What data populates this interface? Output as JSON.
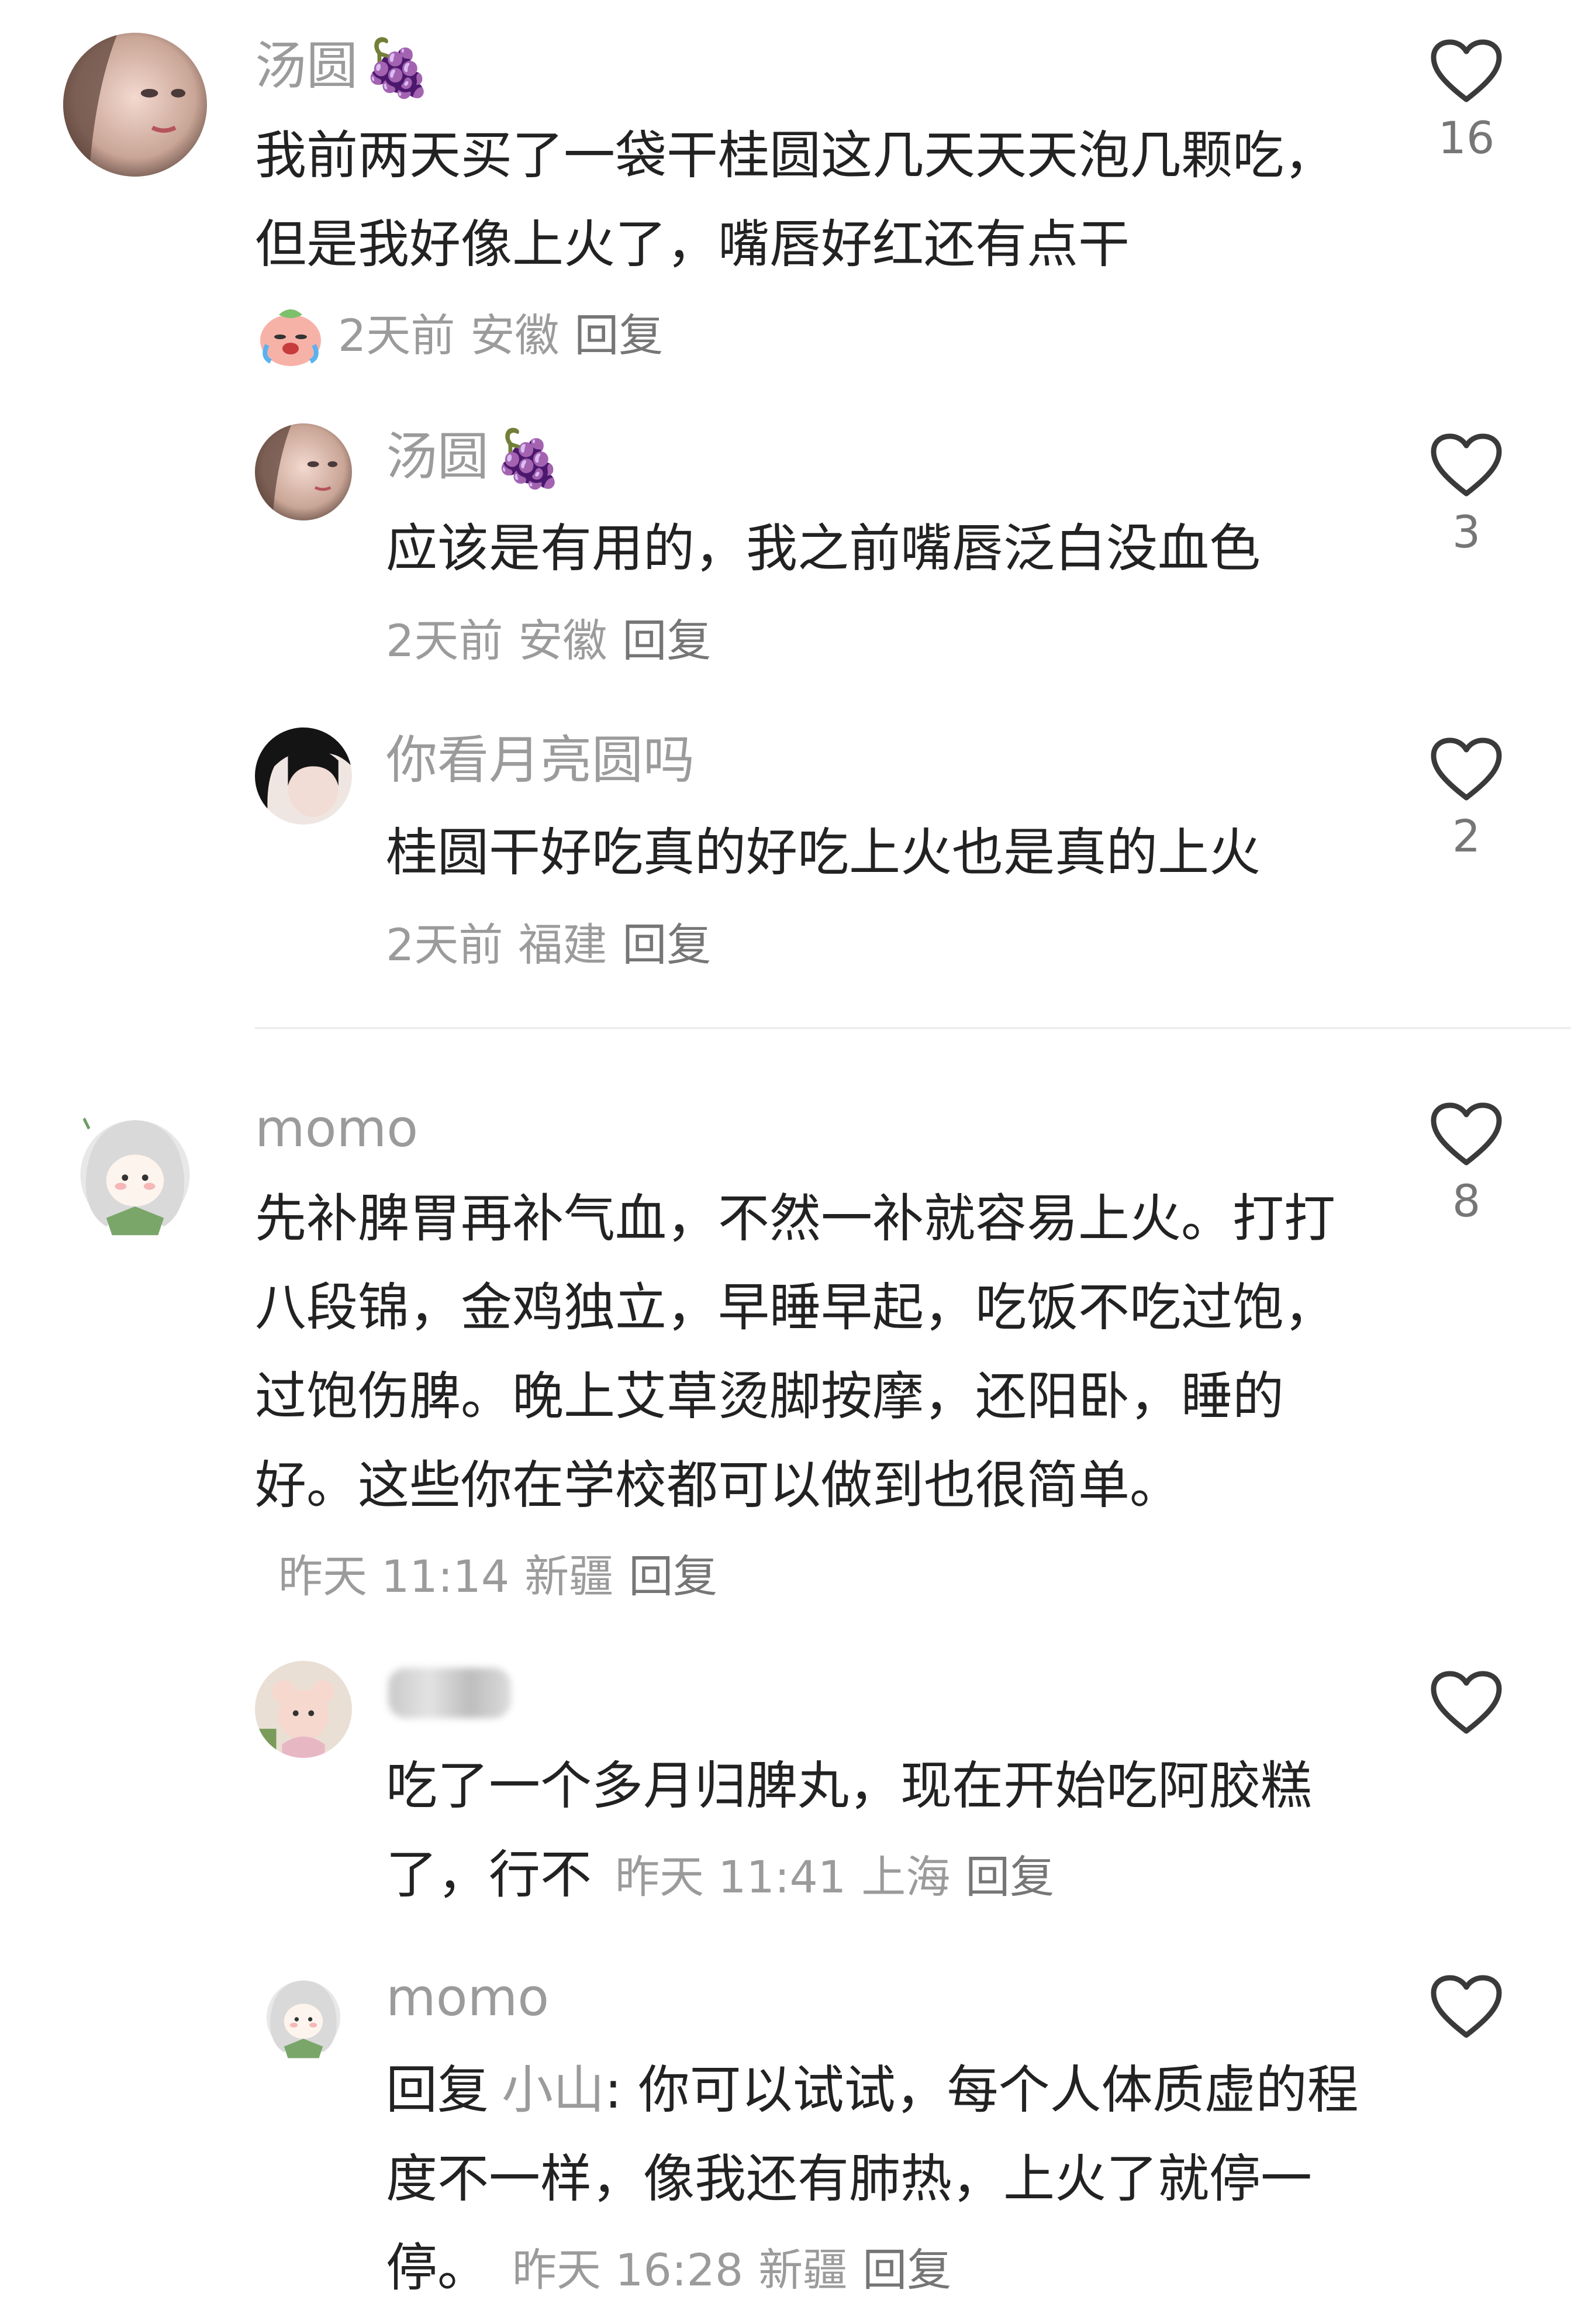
{
  "comments": [
    {
      "user": "汤圆",
      "name_emoji": "🍇",
      "text": "我前两天买了一袋干桂圆这几天天天泡几颗吃，但是我好像上火了，嘴唇好红还有点干",
      "time": "2天前",
      "location": "安徽",
      "reply_label": "回复",
      "likes": "16",
      "inline_emoji": "crying-peach-emoji",
      "replies": [
        {
          "user": "汤圆",
          "name_emoji": "🍇",
          "text": "应该是有用的，我之前嘴唇泛白没血色",
          "time": "2天前",
          "location": "安徽",
          "reply_label": "回复",
          "likes": "3"
        },
        {
          "user": "你看月亮圆吗",
          "text": "桂圆干好吃真的好吃上火也是真的上火",
          "time": "2天前",
          "location": "福建",
          "reply_label": "回复",
          "likes": "2"
        }
      ]
    },
    {
      "user": "momo",
      "text": "先补脾胃再补气血，不然一补就容易上火。打打八段锦，金鸡独立，早睡早起，吃饭不吃过饱，过饱伤脾。晚上艾草烫脚按摩，还阳卧，睡的好。这些你在学校都可以做到也很简单。",
      "time": "昨天 11:14",
      "location": "新疆",
      "reply_label": "回复",
      "likes": "8",
      "replies": [
        {
          "user": "",
          "text": "吃了一个多月归脾丸，现在开始吃阿胶糕了，行不",
          "time": "昨天 11:41",
          "location": "上海",
          "reply_label": "回复",
          "likes": ""
        },
        {
          "user": "momo",
          "reply_prefix": "回复",
          "mention": "小山",
          "text": ": 你可以试试，每个人体质虚的程度不一样，像我还有肺热，上火了就停一停。",
          "time": "昨天 16:28",
          "location": "新疆",
          "reply_label": "回复",
          "likes": ""
        }
      ]
    }
  ],
  "icons": {
    "like": "heart-outline-icon"
  },
  "colors": {
    "text": "#222222",
    "secondary": "#9b9b9b",
    "divider": "#efefef"
  }
}
